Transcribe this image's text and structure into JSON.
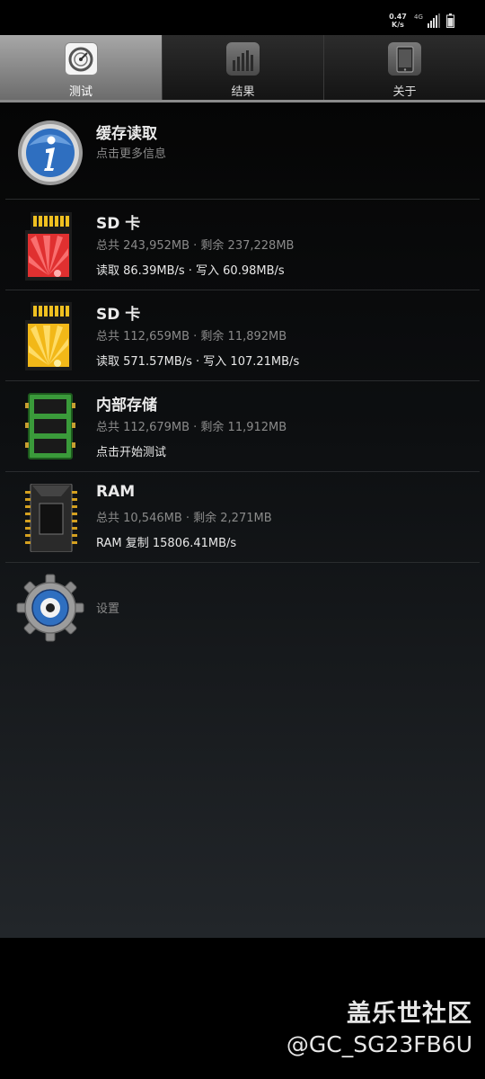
{
  "status_bar": {
    "speed_value": "0.47",
    "speed_unit": "K/s",
    "network": "4G",
    "icons": [
      "network-speed",
      "4g-icon",
      "signal-icon",
      "battery-icon"
    ]
  },
  "tabs": [
    {
      "label": "测试",
      "icon": "gauge-icon",
      "selected": true
    },
    {
      "label": "结果",
      "icon": "bar-chart-icon",
      "selected": false
    },
    {
      "label": "关于",
      "icon": "phone-icon",
      "selected": false
    }
  ],
  "items": [
    {
      "title": "缓存读取",
      "subtitle": "点击更多信息",
      "icon": "info-icon"
    },
    {
      "title": "SD 卡",
      "subtitle": "总共 243,952MB · 剩余 237,228MB",
      "speed": "读取 86.39MB/s · 写入 60.98MB/s",
      "icon": "sd-card-red-icon"
    },
    {
      "title": "SD 卡",
      "subtitle": "总共 112,659MB · 剩余 11,892MB",
      "speed": "读取 571.57MB/s · 写入 107.21MB/s",
      "icon": "sd-card-yellow-icon"
    },
    {
      "title": "内部存储",
      "subtitle": "总共 112,679MB · 剩余 11,912MB",
      "speed": "点击开始测试",
      "icon": "internal-storage-icon"
    },
    {
      "title": "RAM",
      "subtitle": "总共 10,546MB · 剩余 2,271MB",
      "speed": "RAM 复制 15806.41MB/s",
      "icon": "ram-chip-icon"
    }
  ],
  "settings": {
    "label": "设置",
    "icon": "gear-icon"
  },
  "watermark": {
    "title": "盖乐世社区",
    "handle": "@GC_SG23FB6U"
  },
  "colors": {
    "accent_tab": "#8a8a8a",
    "background": "#000000",
    "text_primary": "#eaeaea",
    "text_secondary": "#8a8a8a"
  }
}
